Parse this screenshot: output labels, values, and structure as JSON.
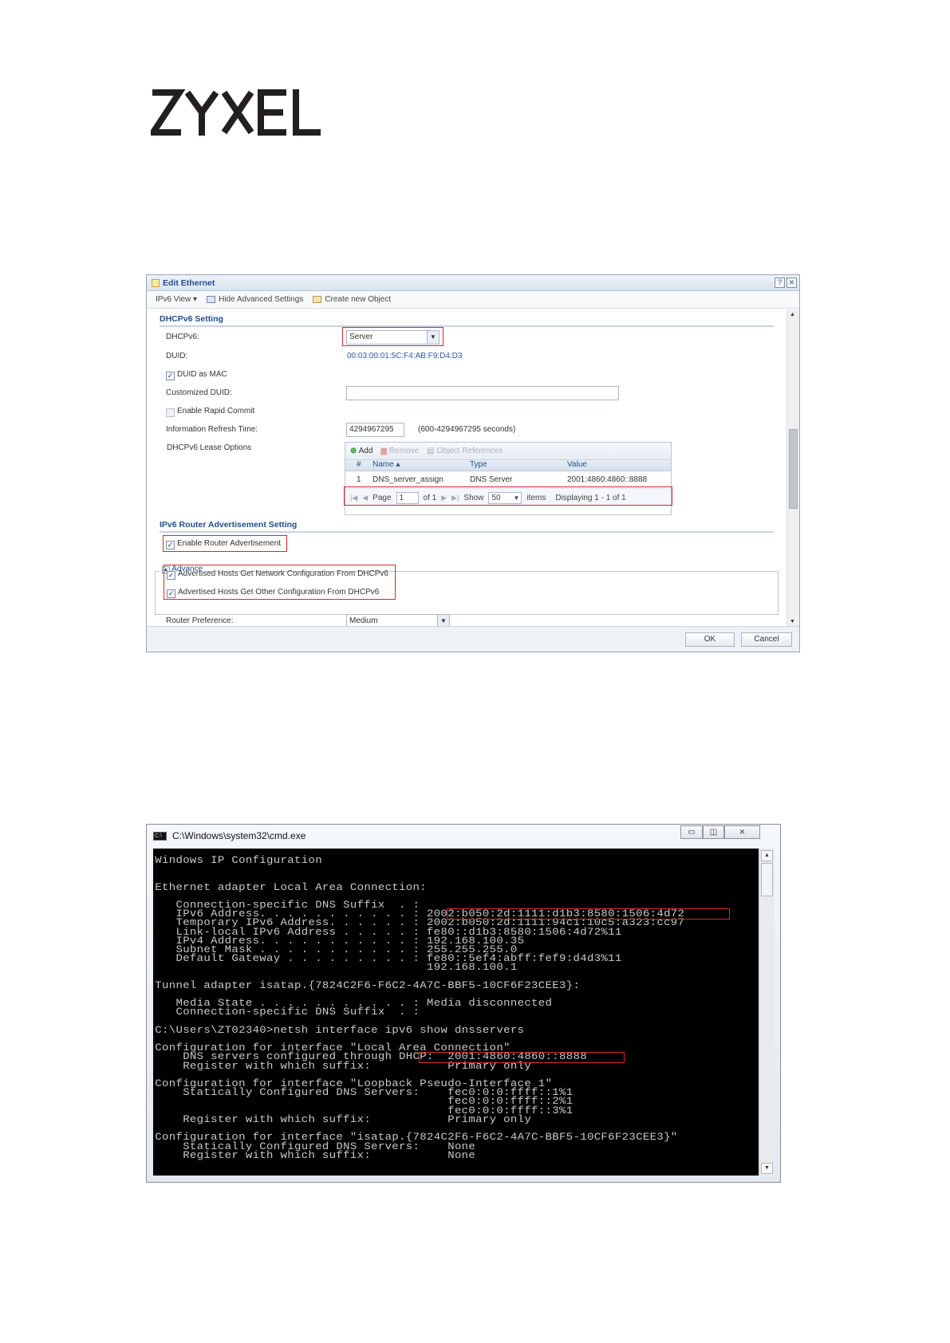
{
  "logo": {
    "text": "ZYXEL"
  },
  "dialog": {
    "title": "Edit Ethernet",
    "help_icon": "help-icon",
    "close_icon": "close-icon",
    "toolbar": {
      "ipv6_view": "IPv6 View ▾",
      "hide_advanced": "Hide Advanced Settings",
      "create_object": "Create new Object"
    },
    "dhcpv6_section": {
      "title": "DHCPv6 Setting",
      "dhcpv6_label": "DHCPv6:",
      "dhcpv6_value": "Server",
      "duid_label": "DUID:",
      "duid_value": "00:03:00:01:5C:F4:AB:F9:D4:D3",
      "duid_as_mac": "DUID as MAC",
      "customized_duid_label": "Customized DUID:",
      "enable_rapid_commit": "Enable Rapid Commit",
      "info_refresh_label": "Information Refresh Time:",
      "info_refresh_value": "4294967295",
      "info_refresh_hint": "(600-4294967295 seconds)",
      "lease_options_label": "DHCPv6 Lease Options"
    },
    "lease_grid": {
      "add": "Add",
      "remove": "Remove",
      "object_references": "Object References",
      "columns": [
        "#",
        "Name ▴",
        "Type",
        "Value"
      ],
      "rows": [
        {
          "num": "1",
          "name": "DNS_server_assign",
          "type": "DNS Server",
          "value": "2001:4860:4860::8888"
        }
      ],
      "paging": {
        "page_label": "Page",
        "page_value": "1",
        "of_label": "of 1",
        "show_label": "Show",
        "show_value": "50",
        "items_label": "items",
        "displaying": "Displaying 1 - 1 of 1"
      }
    },
    "ra_section": {
      "title": "IPv6 Router Advertisement Setting",
      "enable_ra": "Enable Router Advertisement",
      "advance_label": "Advance",
      "hosts_network": "Advertised Hosts Get Network Configuration From DHCPv6",
      "hosts_other": "Advertised Hosts Get Other Configuration From DHCPv6",
      "router_pref_label": "Router Preference:",
      "router_pref_value": "Medium"
    },
    "buttons": {
      "ok": "OK",
      "cancel": "Cancel"
    }
  },
  "cmd": {
    "title": "C:\\Windows\\system32\\cmd.exe",
    "icon_text": "C:\\",
    "minimize": "▭",
    "restore": "◫",
    "close": "⨯",
    "output": "Windows IP Configuration\n\n\nEthernet adapter Local Area Connection:\n\n   Connection-specific DNS Suffix  . :\n   IPv6 Address. . . . . . . . . . . : 2002:b050:2d:1111:d1b3:8580:1506:4d72\n   Temporary IPv6 Address. . . . . . : 2002:b050:2d:1111:94c1:10c5:a323:cc97\n   Link-local IPv6 Address . . . . . : fe80::d1b3:8580:1506:4d72%11\n   IPv4 Address. . . . . . . . . . . : 192.168.100.35\n   Subnet Mask . . . . . . . . . . . : 255.255.255.0\n   Default Gateway . . . . . . . . . : fe80::5ef4:abff:fef9:d4d3%11\n                                       192.168.100.1\n\nTunnel adapter isatap.{7824C2F6-F6C2-4A7C-BBF5-10CF6F23CEE3}:\n\n   Media State . . . . . . . . . . . : Media disconnected\n   Connection-specific DNS Suffix  . :\n\nC:\\Users\\ZT02340>netsh interface ipv6 show dnsservers\n\nConfiguration for interface \"Local Area Connection\"\n    DNS servers configured through DHCP:  2001:4860:4860::8888\n    Register with which suffix:           Primary only\n\nConfiguration for interface \"Loopback Pseudo-Interface 1\"\n    Statically Configured DNS Servers:    fec0:0:0:ffff::1%1\n                                          fec0:0:0:ffff::2%1\n                                          fec0:0:0:ffff::3%1\n    Register with which suffix:           Primary only\n\nConfiguration for interface \"isatap.{7824C2F6-F6C2-4A7C-BBF5-10CF6F23CEE3}\"\n    Statically Configured DNS Servers:    None\n    Register with which suffix:           None"
  }
}
